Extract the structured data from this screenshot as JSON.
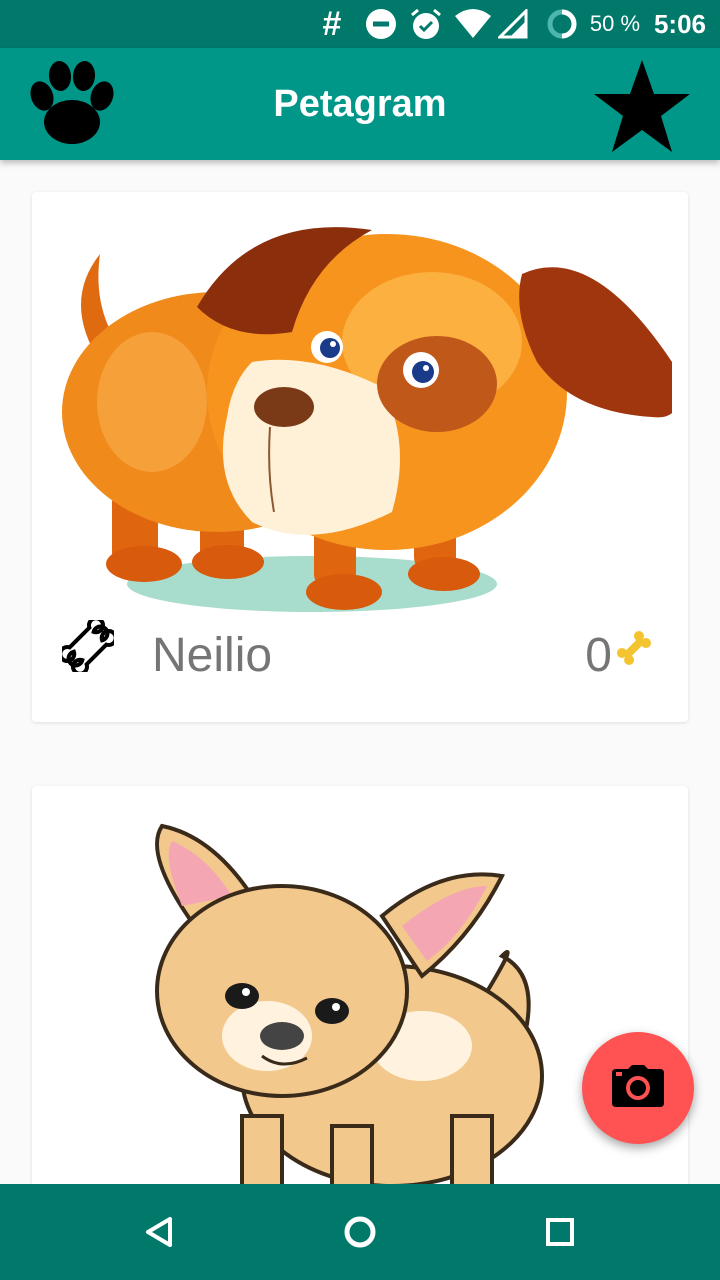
{
  "status_bar": {
    "notification_symbol": "#",
    "battery_percent": "50 %",
    "time": "5:06",
    "icons": [
      "dnd-icon",
      "alarm-icon",
      "wifi-icon",
      "signal-icon",
      "battery-ring-icon"
    ]
  },
  "app_bar": {
    "title": "Petagram",
    "left_icon": "paw-icon",
    "right_icon": "star-icon"
  },
  "pets": [
    {
      "name": "Neilio",
      "likes": "0",
      "image": "orange-puppy-image"
    },
    {
      "name": "",
      "likes": "",
      "image": "chihuahua-image"
    }
  ],
  "fab": {
    "icon": "camera-icon"
  },
  "nav_bar": {
    "icons": [
      "back-icon",
      "home-icon",
      "recents-icon"
    ]
  },
  "colors": {
    "status_bar": "#00796b",
    "app_bar": "#009688",
    "fab": "#ff5252",
    "name_text": "#757575"
  }
}
